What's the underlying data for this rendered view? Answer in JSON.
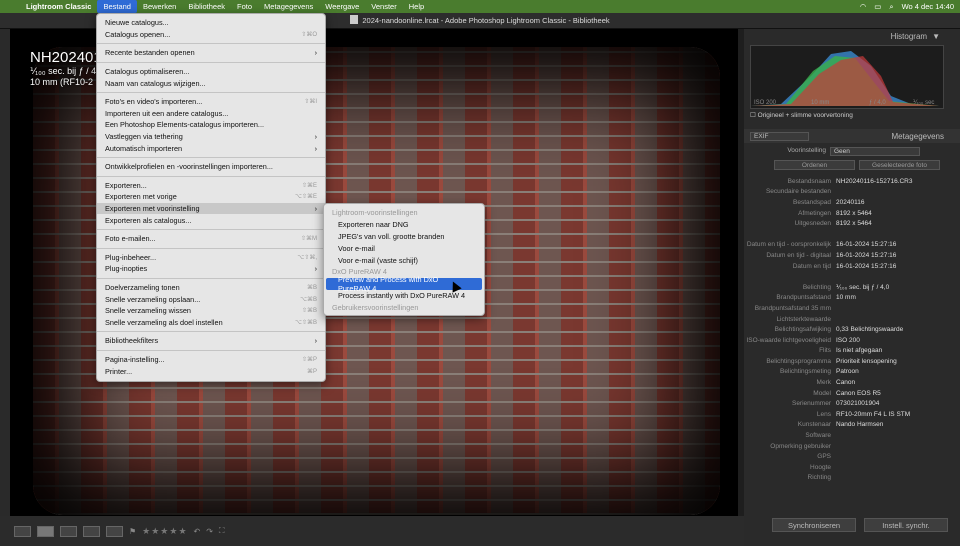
{
  "menubar": {
    "apple": "",
    "app": "Lightroom Classic",
    "items": [
      "Bestand",
      "Bewerken",
      "Bibliotheek",
      "Foto",
      "Metagegevens",
      "Weergave",
      "Venster",
      "Help"
    ],
    "clock": "Wo 4 dec  14:40"
  },
  "window": {
    "title": "2024-nandoonline.lrcat - Adobe Photoshop Lightroom Classic - Bibliotheek"
  },
  "overlay": {
    "filename": "NH202401",
    "line2": "⅟₁₀₀ sec. bij ƒ / 4",
    "line3": "10 mm (RF10-2"
  },
  "menu": {
    "groups": [
      [
        {
          "label": "Nieuwe catalogus..."
        },
        {
          "label": "Catalogus openen...",
          "shortcut": "⇧⌘O"
        }
      ],
      [
        {
          "label": "Recente bestanden openen",
          "arrow": "›"
        }
      ],
      [
        {
          "label": "Catalogus optimaliseren..."
        },
        {
          "label": "Naam van catalogus wijzigen..."
        }
      ],
      [
        {
          "label": "Foto's en video's importeren...",
          "shortcut": "⇧⌘I"
        },
        {
          "label": "Importeren uit een andere catalogus..."
        },
        {
          "label": "Een Photoshop Elements-catalogus importeren..."
        },
        {
          "label": "Vastleggen via tethering",
          "arrow": "›"
        },
        {
          "label": "Automatisch importeren",
          "arrow": "›"
        }
      ],
      [
        {
          "label": "Ontwikkelprofielen en -voorinstellingen importeren..."
        }
      ],
      [
        {
          "label": "Exporteren...",
          "shortcut": "⇧⌘E"
        },
        {
          "label": "Exporteren met vorige",
          "shortcut": "⌥⇧⌘E"
        },
        {
          "label": "Exporteren met voorinstelling",
          "arrow": "›",
          "highlight": true
        },
        {
          "label": "Exporteren als catalogus..."
        }
      ],
      [
        {
          "label": "Foto e-mailen...",
          "shortcut": "⇧⌘M"
        }
      ],
      [
        {
          "label": "Plug-inbeheer...",
          "shortcut": "⌥⇧⌘,"
        },
        {
          "label": "Plug-inopties",
          "arrow": "›"
        }
      ],
      [
        {
          "label": "Doelverzameling tonen",
          "shortcut": "⌘B"
        },
        {
          "label": "Snelle verzameling opslaan...",
          "shortcut": "⌥⌘B"
        },
        {
          "label": "Snelle verzameling wissen",
          "shortcut": "⇧⌘B"
        },
        {
          "label": "Snelle verzameling als doel instellen",
          "shortcut": "⌥⇧⌘B"
        }
      ],
      [
        {
          "label": "Bibliotheekfilters",
          "arrow": "›"
        }
      ],
      [
        {
          "label": "Pagina-instelling...",
          "shortcut": "⇧⌘P"
        },
        {
          "label": "Printer...",
          "shortcut": "⌘P"
        }
      ]
    ]
  },
  "submenu": {
    "items": [
      {
        "type": "header",
        "label": "Lightroom-voorinstellingen"
      },
      {
        "label": "Exporteren naar DNG"
      },
      {
        "label": "JPEG's van voll. grootte branden"
      },
      {
        "label": "Voor e-mail"
      },
      {
        "label": "Voor e-mail (vaste schijf)"
      },
      {
        "type": "header",
        "label": "DxO PureRAW 4"
      },
      {
        "label": "Preview and Process with DxO PureRAW 4",
        "selected": true
      },
      {
        "label": "Process instantly with DxO PureRAW 4"
      },
      {
        "type": "header",
        "label": "Gebruikersvoorinstellingen"
      }
    ]
  },
  "histogram": {
    "title": "Histogram",
    "iso": "ISO 200",
    "focal": "10 mm",
    "aperture": "ƒ / 4,0",
    "shutter": "⅟₁₀₀ sec",
    "original": "Origineel + slimme voorvertoning"
  },
  "metadata": {
    "title": "Metagegevens",
    "dropdown": "EXIF",
    "preset_label": "Voorinstelling",
    "preset_value": "Geen",
    "buttons": [
      "Ordenen",
      "Geselecteerde foto"
    ],
    "rows": [
      {
        "k": "Bestandsnaam",
        "v": "NH20240116-152716.CR3"
      },
      {
        "k": "Secundaire bestanden",
        "v": ""
      },
      {
        "k": "Bestandspad",
        "v": "20240116"
      },
      {
        "k": "Afmetingen",
        "v": "8192 x 5464"
      },
      {
        "k": "Uitgesneden",
        "v": "8192 x 5464"
      },
      {
        "k": "",
        "v": ""
      },
      {
        "k": "Datum en tijd - oorspronkelijk",
        "v": "16-01-2024 15:27:16"
      },
      {
        "k": "Datum en tijd - digitaal",
        "v": "16-01-2024 15:27:16"
      },
      {
        "k": "Datum en tijd",
        "v": "16-01-2024 15:27:16"
      },
      {
        "k": "",
        "v": ""
      },
      {
        "k": "Belichting",
        "v": "⅟₁₀₀ sec. bij ƒ / 4,0"
      },
      {
        "k": "Brandpuntsafstand",
        "v": "10 mm"
      },
      {
        "k": "Brandpuntsafstand 35 mm",
        "v": ""
      },
      {
        "k": "Lichtsterktewaarde",
        "v": ""
      },
      {
        "k": "Belichtingsafwijking",
        "v": "0,33 Belichtingswaarde"
      },
      {
        "k": "ISO-waarde lichtgevoeligheid",
        "v": "ISO 200"
      },
      {
        "k": "Flits",
        "v": "Is niet afgegaan"
      },
      {
        "k": "Belichtingsprogramma",
        "v": "Prioriteit lensopening"
      },
      {
        "k": "Belichtingsmeting",
        "v": "Patroon"
      },
      {
        "k": "Merk",
        "v": "Canon"
      },
      {
        "k": "Model",
        "v": "Canon EOS R5"
      },
      {
        "k": "Serienummer",
        "v": "073021001904"
      },
      {
        "k": "Lens",
        "v": "RF10-20mm F4 L IS STM"
      },
      {
        "k": "Kunstenaar",
        "v": "Nando Harmsen"
      },
      {
        "k": "Software",
        "v": ""
      },
      {
        "k": "Opmerking gebruiker",
        "v": ""
      },
      {
        "k": "GPS",
        "v": ""
      },
      {
        "k": "Hoogte",
        "v": ""
      },
      {
        "k": "Richting",
        "v": ""
      }
    ]
  },
  "sync": {
    "left": "Synchroniseren",
    "right": "Instell. synchr."
  }
}
